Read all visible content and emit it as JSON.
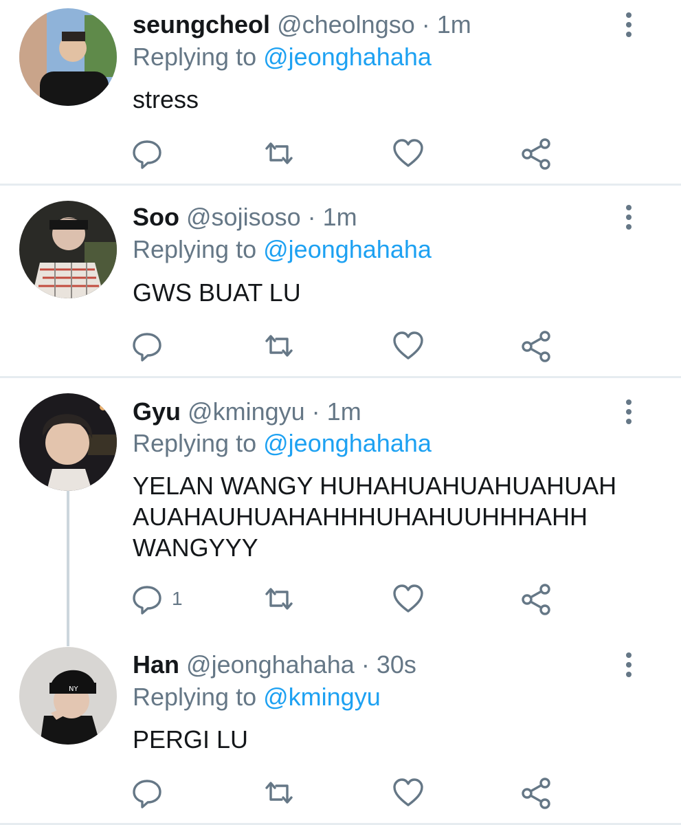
{
  "tweets": [
    {
      "name": "seungcheol",
      "handle": "@cheolngso",
      "separator": "·",
      "time": "1m",
      "replying_prefix": "Replying to",
      "replying_to": "@jeonghahaha",
      "text": "stress",
      "reply_count": "",
      "avatar_icon": "profile-photo"
    },
    {
      "name": "Soo",
      "handle": "@sojisoso",
      "separator": "·",
      "time": "1m",
      "replying_prefix": "Replying to",
      "replying_to": "@jeonghahaha",
      "text": "GWS BUAT LU",
      "reply_count": "",
      "avatar_icon": "profile-photo"
    },
    {
      "name": "Gyu",
      "handle": "@kmingyu",
      "separator": "·",
      "time": "1m",
      "replying_prefix": "Replying to",
      "replying_to": "@jeonghahaha",
      "text": "YELAN WANGY HUHAHUAHUAHUAHUAH\nAUAHAUHUAHAHHHUHAHUUHHHAHH\nWANGYYY",
      "reply_count": "1",
      "avatar_icon": "profile-photo"
    },
    {
      "name": "Han",
      "handle": "@jeonghahaha",
      "separator": "·",
      "time": "30s",
      "replying_prefix": "Replying to",
      "replying_to": "@kmingyu",
      "text": "PERGI LU",
      "reply_count": "",
      "avatar_icon": "profile-photo"
    }
  ],
  "icons": {
    "reply": "reply-icon",
    "retweet": "retweet-icon",
    "like": "like-icon",
    "share": "share-icon",
    "menu": "more-vertical-icon"
  },
  "colors": {
    "text": "#14171a",
    "secondary": "#657786",
    "accent": "#1da1f2",
    "divider": "#e6ecf0",
    "thread_line": "#ccd6dd"
  }
}
